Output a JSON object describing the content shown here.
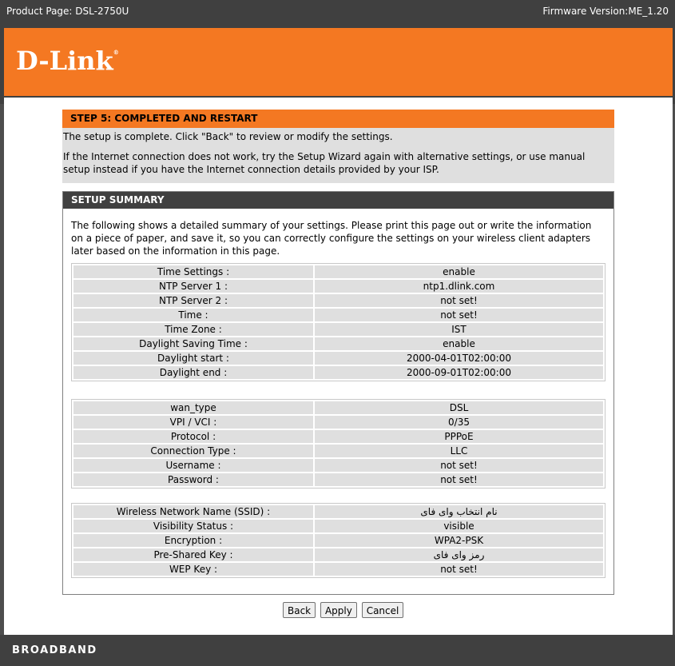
{
  "header": {
    "product_page": "Product Page: DSL-2750U",
    "firmware_version": "Firmware Version:ME_1.20"
  },
  "brand": {
    "logo_text": "D-Link",
    "logo_mark": "®",
    "color": "#f47822"
  },
  "step": {
    "title": "STEP 5: COMPLETED AND RESTART",
    "line1": "The setup is complete. Click \"Back\" to review or modify the settings.",
    "line2": "If the Internet connection does not work, try the Setup Wizard again with alternative settings, or use manual setup instead if you have the Internet connection details provided by your ISP."
  },
  "summary": {
    "title": "SETUP SUMMARY",
    "intro": "The following shows a detailed summary of your settings. Please print this page out or write the information on a piece of paper, and save it, so you can correctly configure the settings on your wireless client adapters later based on the information in this page.",
    "time_group": [
      {
        "label": "Time Settings :",
        "value": "enable"
      },
      {
        "label": "NTP Server 1 :",
        "value": "ntp1.dlink.com"
      },
      {
        "label": "NTP Server 2 :",
        "value": "not set!"
      },
      {
        "label": "Time :",
        "value": "not set!"
      },
      {
        "label": "Time Zone :",
        "value": "IST"
      },
      {
        "label": "Daylight Saving Time :",
        "value": "enable"
      },
      {
        "label": "Daylight start :",
        "value": "2000-04-01T02:00:00"
      },
      {
        "label": "Daylight end :",
        "value": "2000-09-01T02:00:00"
      }
    ],
    "wan_group": [
      {
        "label": "wan_type",
        "value": "DSL"
      },
      {
        "label": "VPI / VCI :",
        "value": "0/35"
      },
      {
        "label": "Protocol :",
        "value": "PPPoE"
      },
      {
        "label": "Connection Type :",
        "value": "LLC"
      },
      {
        "label": "Username :",
        "value": "not set!"
      },
      {
        "label": "Password :",
        "value": "not set!"
      }
    ],
    "wireless_group": [
      {
        "label": "Wireless Network Name (SSID) :",
        "value": "نام انتخاب وای فای"
      },
      {
        "label": "Visibility Status :",
        "value": "visible"
      },
      {
        "label": "Encryption :",
        "value": "WPA2-PSK"
      },
      {
        "label": "Pre-Shared Key :",
        "value": "رمز وای فای"
      },
      {
        "label": "WEP Key :",
        "value": "not set!"
      }
    ]
  },
  "buttons": {
    "back": "Back",
    "apply": "Apply",
    "cancel": "Cancel"
  },
  "footer": {
    "text": "BROADBAND"
  }
}
